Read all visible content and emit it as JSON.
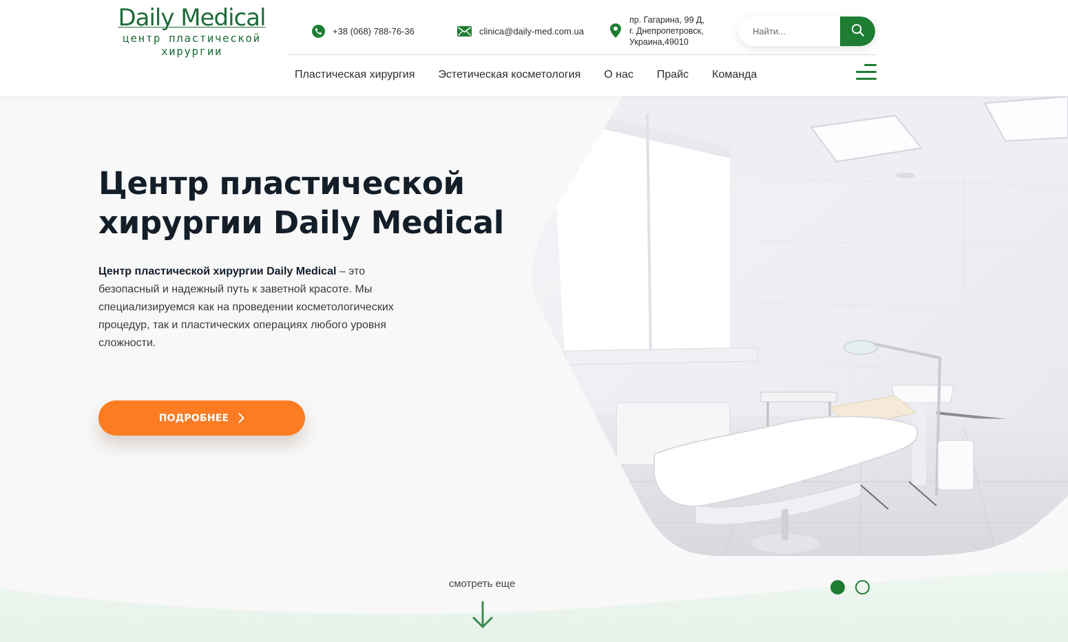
{
  "logo": {
    "title": "Daily Medical",
    "subtitle_line1": "центр пластической",
    "subtitle_line2": "хирургии"
  },
  "contacts": {
    "phone": "+38 (068) 788-76-36",
    "email": "clinica@daily-med.com.ua",
    "address_line1": "пр. Гагарина, 99 Д,",
    "address_line2": "г. Днепропетровск,",
    "address_line3": "Украина,49010"
  },
  "search": {
    "placeholder": "Найти..."
  },
  "nav": {
    "items": [
      "Пластическая хирургия",
      "Эстетическая косметология",
      "О нас",
      "Прайс",
      "Команда"
    ]
  },
  "hero": {
    "title_line1": "Центр пластической",
    "title_line2": "хирургии Daily Medical",
    "text_bold": "Центр пластической хирургии Daily Medical",
    "text_rest": " – это безопасный и надежный путь к заветной красоте. Мы специализируемся как на проведении косметологических процедур, так и пластических операциях любого уровня сложности.",
    "cta_label": "ПОДРОБНЕЕ",
    "see_more": "смотреть еще"
  },
  "slider": {
    "count": 2,
    "active": 1
  },
  "colors": {
    "brand_green": "#1e7d32",
    "accent_orange": "#fb7c22",
    "title_dark": "#131e29"
  },
  "icons": {
    "phone": "phone-icon",
    "email": "envelope-icon",
    "address": "map-pin-icon",
    "search": "search-icon",
    "menu": "hamburger-menu-icon",
    "cta": "chevron-right-icon",
    "scroll": "arrow-down-icon"
  }
}
